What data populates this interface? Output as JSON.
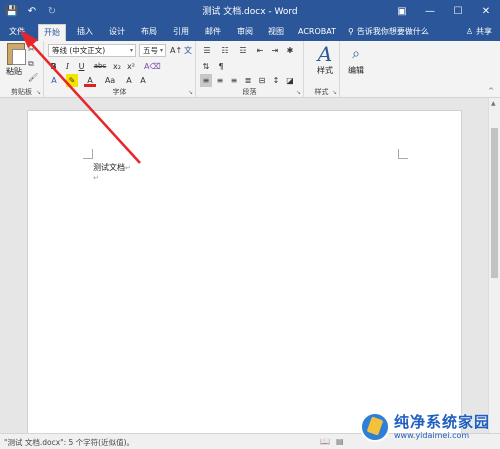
{
  "window": {
    "title": "测试 文档.docx - Word",
    "controls": [
      "restore-icon",
      "minimize-icon",
      "maximize-icon",
      "close-icon"
    ]
  },
  "qat": {
    "icons": [
      "save-icon",
      "undo-icon",
      "redo-icon"
    ]
  },
  "tabs": [
    "文件",
    "开始",
    "插入",
    "设计",
    "布局",
    "引用",
    "邮件",
    "审阅",
    "视图",
    "ACROBAT"
  ],
  "active_tab": "开始",
  "tell_me": "告诉我你想要做什么",
  "share_label": "共享",
  "ribbon": {
    "clipboard": {
      "paste_label": "粘贴",
      "group_label": "剪贴板"
    },
    "font": {
      "font_name": "等线 (中文正文)",
      "font_size": "五号",
      "group_label": "字体",
      "buttons": [
        "B",
        "I",
        "U",
        "abc",
        "x₂",
        "x²",
        "A",
        "Aa",
        "A",
        "A"
      ]
    },
    "paragraph": {
      "group_label": "段落"
    },
    "styles": {
      "label": "样式",
      "group_label": "样式"
    },
    "editing": {
      "label": "编辑"
    }
  },
  "document": {
    "text": "测试文档",
    "para_mark": "↵"
  },
  "status": {
    "text": "\"测试 文档.docx\": 5 个字符(近似值)。"
  },
  "watermark": {
    "cn": "纯净系统家园",
    "url": "www.yidaimei.com"
  },
  "colors": {
    "word_blue": "#2b579a",
    "annotation_red": "#e8262a",
    "font_color_red": "#e02020",
    "highlight_yellow": "#f5e400"
  }
}
